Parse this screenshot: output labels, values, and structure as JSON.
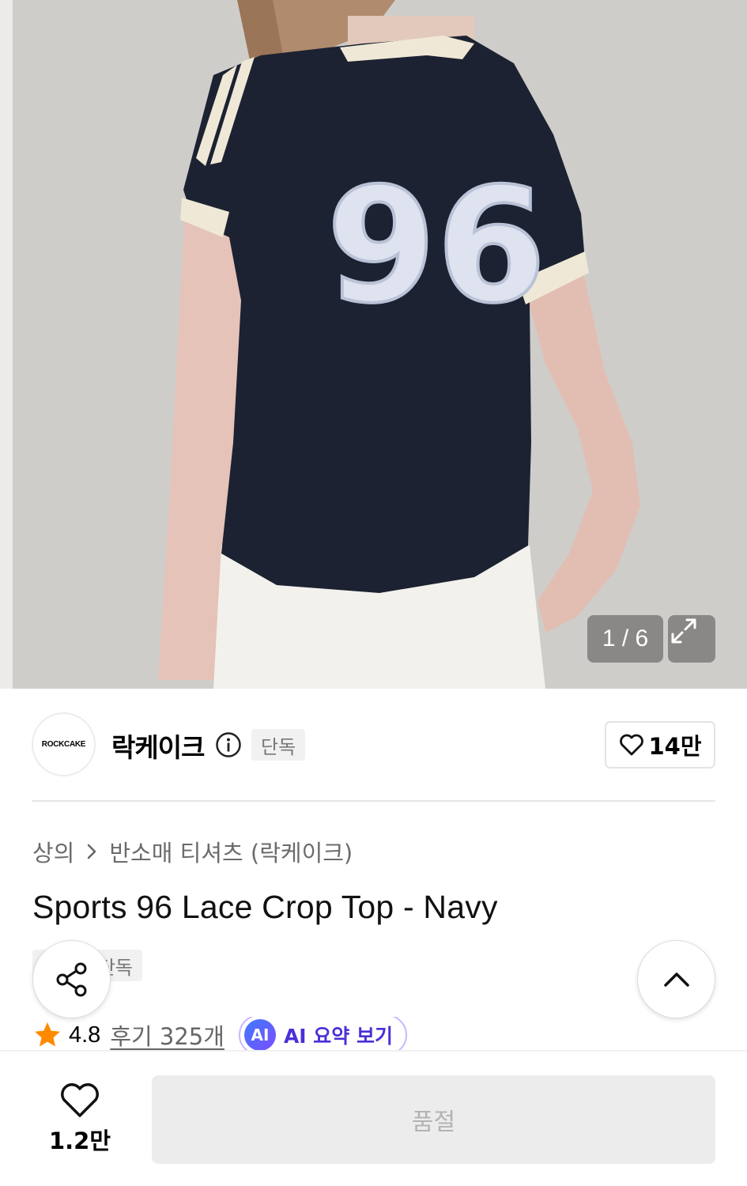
{
  "gallery": {
    "counter": "1 / 6",
    "product_number": "96",
    "colors": {
      "shirt": "#1c2231",
      "trim": "#efe8d6",
      "background": "#cfcdca"
    }
  },
  "brand": {
    "logo_text": "ROCKCAKE",
    "name": "락케이크",
    "exclusive_badge": "단독",
    "like_count": "14만"
  },
  "breadcrumb": {
    "category": "상의",
    "subcategory": "반소매 티셔츠 (락케이크)"
  },
  "product": {
    "title": "Sports 96 Lace Crop Top - Navy",
    "badge": "단독",
    "rating": "4.8",
    "reviews": "후기 325개",
    "ai_chip": "AI",
    "ai_summary": "AI 요약 보기"
  },
  "bottom_bar": {
    "like_count": "1.2만",
    "buy_label": "품절"
  },
  "icons": {
    "info": "info-icon",
    "heart": "heart-icon",
    "star": "star-icon",
    "share": "share-icon",
    "expand": "expand-icon",
    "chevron_up": "chevron-up-icon"
  },
  "accent_colors": {
    "star": "#ff8a00",
    "ai": "#4b2fd6"
  }
}
